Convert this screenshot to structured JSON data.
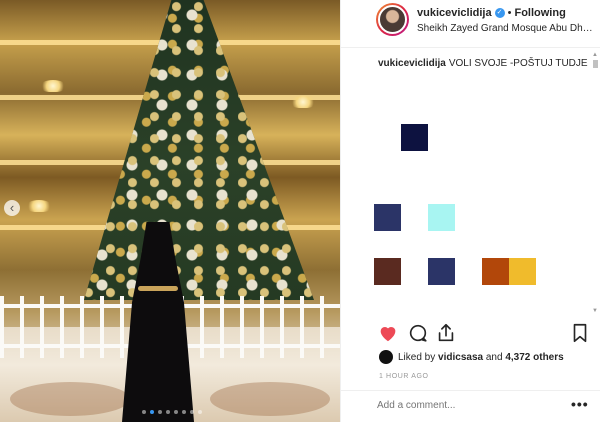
{
  "post": {
    "username": "vukiceviclidija",
    "follow_separator": "•",
    "follow_label": "Following",
    "location": "Sheikh Zayed Grand Mosque Abu Dhabi, U...",
    "caption_user": "vukiceviclidija",
    "caption_text": "VOLI SVOJE -POŠTUJ TUDJE",
    "liked_by_prefix": "Liked by",
    "liked_by_user": "vidicsasa",
    "liked_by_and": "and",
    "likes_count": "4,372 others",
    "time": "1 HOUR AGO",
    "comment_placeholder": "Add a comment...",
    "more_label": "•••",
    "carousel_prev": "‹"
  },
  "icons": {
    "verified": "verified-badge-icon",
    "like": "heart-icon",
    "comment": "speech-bubble-icon",
    "share": "share-icon",
    "save": "bookmark-icon"
  },
  "colors": {
    "like_red": "#ed4956",
    "verified_blue": "#3897f0",
    "emoji_navy": "#0d1240",
    "emoji_slate": "#2b3467",
    "emoji_cyan": "#a8f5f2",
    "emoji_brown": "#5a2a20",
    "emoji_orange": "#b2470a",
    "emoji_yellow": "#f0bb2c"
  },
  "carousel": {
    "count": 8,
    "active_index": 1
  }
}
